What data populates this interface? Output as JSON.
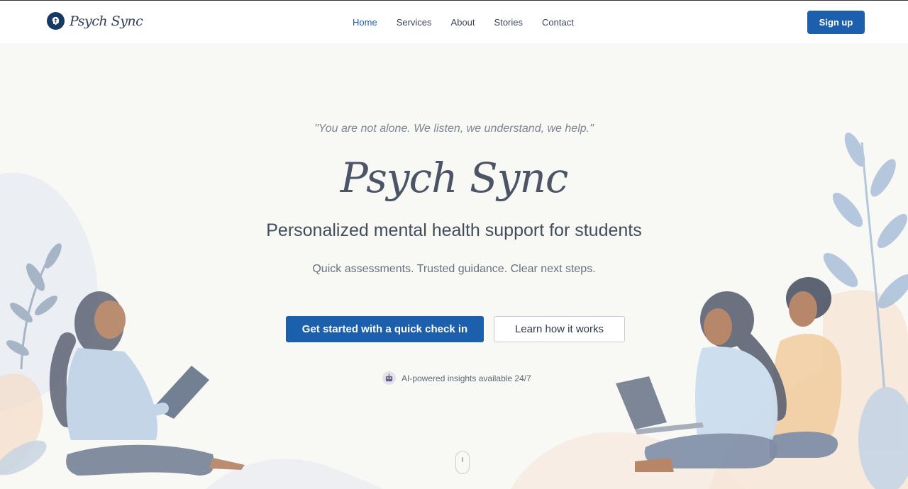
{
  "header": {
    "logo_text": "Psych Sync",
    "nav": [
      {
        "label": "Home",
        "active": true
      },
      {
        "label": "Services",
        "active": false
      },
      {
        "label": "About",
        "active": false
      },
      {
        "label": "Stories",
        "active": false
      },
      {
        "label": "Contact",
        "active": false
      }
    ],
    "signup_label": "Sign up"
  },
  "hero": {
    "quote": "\"You are not alone. We listen, we understand, we help.\"",
    "brand": "Psych Sync",
    "headline": "Personalized mental health support for students",
    "subheadline": "Quick assessments. Trusted guidance. Clear next steps.",
    "cta_primary": "Get started with a quick check in",
    "cta_secondary": "Learn how it works",
    "ai_note": "AI-powered insights available 24/7"
  },
  "icons": {
    "logo": "brain-logo-icon",
    "ai": "robot-icon",
    "scroll": "mouse-scroll-icon"
  },
  "colors": {
    "accent": "#1b5fad",
    "nav_active": "#1a5fad",
    "text_dark": "#424d5c",
    "background": "#f8f8f5"
  }
}
